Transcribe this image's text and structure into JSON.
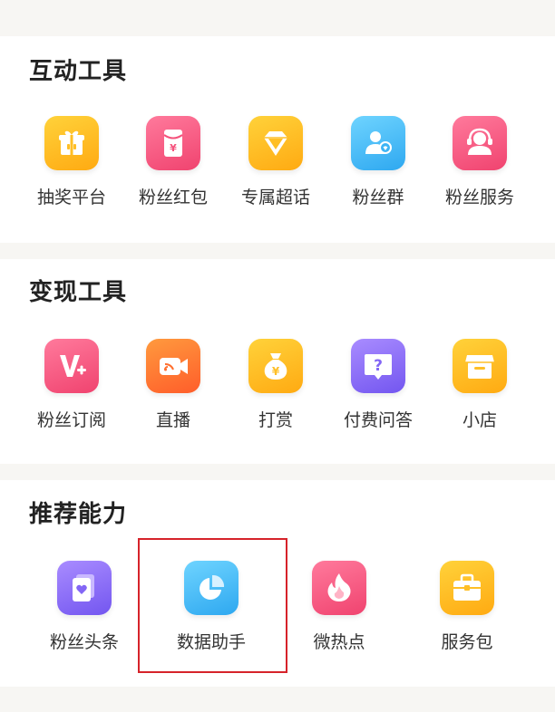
{
  "sections": [
    {
      "title": "互动工具",
      "items": [
        {
          "label": "抽奖平台",
          "icon": "gift-icon"
        },
        {
          "label": "粉丝红包",
          "icon": "red-packet-icon"
        },
        {
          "label": "专属超话",
          "icon": "diamond-icon"
        },
        {
          "label": "粉丝群",
          "icon": "group-icon"
        },
        {
          "label": "粉丝服务",
          "icon": "fan-service-icon"
        }
      ]
    },
    {
      "title": "变现工具",
      "items": [
        {
          "label": "粉丝订阅",
          "icon": "v-plus-icon"
        },
        {
          "label": "直播",
          "icon": "live-camera-icon"
        },
        {
          "label": "打赏",
          "icon": "money-bag-icon"
        },
        {
          "label": "付费问答",
          "icon": "question-icon"
        },
        {
          "label": "小店",
          "icon": "shop-icon"
        }
      ]
    },
    {
      "title": "推荐能力",
      "items": [
        {
          "label": "粉丝头条",
          "icon": "fan-headline-icon"
        },
        {
          "label": "数据助手",
          "icon": "pie-chart-icon"
        },
        {
          "label": "微热点",
          "icon": "flame-icon"
        },
        {
          "label": "服务包",
          "icon": "briefcase-icon"
        }
      ]
    }
  ],
  "highlight_color": "#d6232a",
  "icon_colors": {
    "yellow": "#ffb81c",
    "pink": "#f5527c",
    "blue": "#3cb4f5",
    "orange": "#ff6f2f",
    "purple": "#8366f5"
  }
}
